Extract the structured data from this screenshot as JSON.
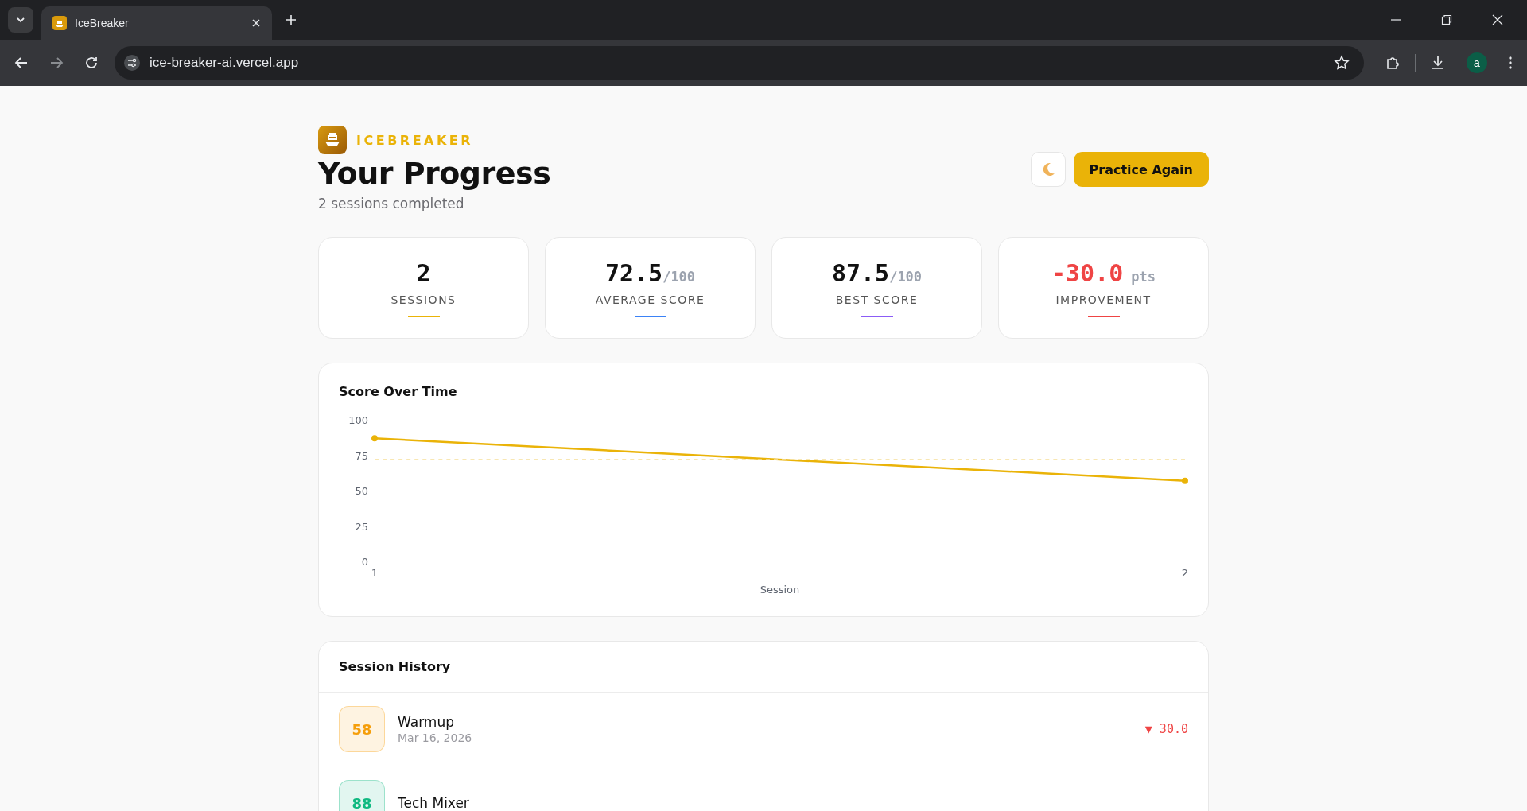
{
  "browser": {
    "tab_title": "IceBreaker",
    "url": "ice-breaker-ai.vercel.app",
    "profile": "a"
  },
  "header": {
    "brand": "ICEBREAKER",
    "title": "Your Progress",
    "subtitle": "2 sessions completed",
    "practice_button": "Practice Again"
  },
  "stats": [
    {
      "value": "2",
      "label": "SESSIONS",
      "color": "#eab308",
      "kind": "neutral"
    },
    {
      "value": "72.5",
      "unit": "/100",
      "label": "AVERAGE SCORE",
      "color": "#3b82f6",
      "kind": "neutral"
    },
    {
      "value": "87.5",
      "unit": "/100",
      "label": "BEST SCORE",
      "color": "#8b5cf6",
      "kind": "neutral"
    },
    {
      "value": "-30.0",
      "unit": "pts",
      "label": "IMPROVEMENT",
      "color": "#ef4444",
      "kind": "negative"
    }
  ],
  "chart": {
    "title": "Score Over Time",
    "chart_data": {
      "type": "line",
      "xlabel": "Session",
      "categories": [
        "1",
        "2"
      ],
      "series": [
        {
          "color": "#eab308",
          "values": [
            87.5,
            57.5
          ],
          "marker": "circle"
        },
        {
          "color": "#f6df9a",
          "values": [
            72.5,
            72.5
          ],
          "line_style": "dashed"
        }
      ],
      "ylim": [
        0,
        100
      ],
      "yticks": [
        0,
        25,
        50,
        75,
        100
      ]
    }
  },
  "history": {
    "title": "Session History",
    "sessions": [
      {
        "score": "58",
        "name": "Warmup",
        "date": "Mar 16, 2026",
        "delta": "▼ 30.0",
        "negative": true,
        "color": "#f59e0b"
      },
      {
        "score": "88",
        "name": "Tech Mixer",
        "color": "#10b981"
      }
    ]
  }
}
